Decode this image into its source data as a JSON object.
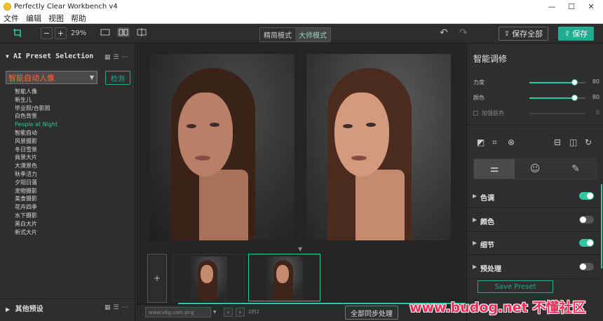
{
  "titlebar": {
    "title": "Perfectly Clear Workbench v4",
    "minimize": "—",
    "maximize": "☐",
    "close": "✕"
  },
  "menu": [
    "文件",
    "编辑",
    "视图",
    "帮助"
  ],
  "toolbar": {
    "zoom_out": "−",
    "zoom_in": "+",
    "zoom_level": "29%",
    "mode_simple": "精简模式",
    "mode_master": "大师模式",
    "save_all": "保存全部",
    "save": "保存"
  },
  "left_panel": {
    "header": "AI Preset Selection",
    "selected_preset": "智能自动人像",
    "detect_button": "检测",
    "presets": [
      "智能人像",
      "新生儿",
      "毕业照/合影照",
      "白色背景",
      "People at Night",
      "智能自动",
      "风景摄影",
      "冬日雪景",
      "商景大片",
      "大漠景色",
      "秋季活力",
      "夕阳日落",
      "宠物摄影",
      "美食摄影",
      "花卉四季",
      "水下摄影",
      "黑白大片",
      "新式大片"
    ],
    "active_preset_index": 4,
    "other_presets": "其他预设"
  },
  "center": {
    "file_name": "www.x6g.com.png",
    "page_count": "2的2",
    "sync_button": "全部同步处理",
    "add_thumb": "+"
  },
  "right_panel": {
    "title": "智能调修",
    "sliders": [
      {
        "label": "力度",
        "value": "80",
        "level": 0.8
      },
      {
        "label": "颜色",
        "value": "80",
        "level": 0.8
      }
    ],
    "checkbox": {
      "label": "加强肤色",
      "value": "0"
    },
    "sections": [
      {
        "name": "色调",
        "on": true
      },
      {
        "name": "颜色",
        "on": false
      },
      {
        "name": "细节",
        "on": true
      },
      {
        "name": "预处理",
        "on": false
      }
    ],
    "save_preset": "Save Preset"
  },
  "watermark": "www.budog.net 不懂社区",
  "colors": {
    "accent": "#2ec79f",
    "preset_orange": "#ff6a2b",
    "save_green": "#1fae8f"
  }
}
